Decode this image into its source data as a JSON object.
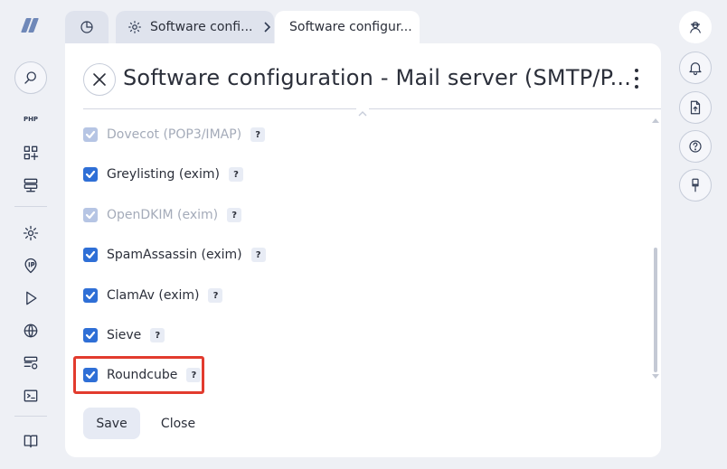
{
  "tabs": [
    {
      "label": "Software confi...",
      "icon": "gear-icon"
    },
    {
      "label": "Software configur..."
    }
  ],
  "panel": {
    "title": "Software configuration - Mail server (SMTP/P...",
    "options": [
      {
        "label": "Dovecot (POP3/IMAP)",
        "checked": true,
        "disabled": true
      },
      {
        "label": "Greylisting (exim)",
        "checked": true,
        "disabled": false
      },
      {
        "label": "OpenDKIM (exim)",
        "checked": true,
        "disabled": true
      },
      {
        "label": "SpamAssassin (exim)",
        "checked": true,
        "disabled": false
      },
      {
        "label": "ClamAv (exim)",
        "checked": true,
        "disabled": false
      },
      {
        "label": "Sieve",
        "checked": true,
        "disabled": false
      },
      {
        "label": "Roundcube",
        "checked": true,
        "disabled": false,
        "highlighted": true
      }
    ],
    "help_label": "?",
    "save_label": "Save",
    "close_label": "Close"
  },
  "left_rail": {
    "php_label": "PHP",
    "icons": [
      "search-icon",
      "php-icon",
      "apps-add-icon",
      "server-icon",
      "gear-icon",
      "ip-icon",
      "play-icon",
      "globe-icon",
      "server-settings-icon",
      "terminal-icon",
      "book-icon"
    ]
  },
  "right_rail": {
    "icons": [
      "avatar-icon",
      "bell-icon",
      "upload-file-icon",
      "help-circle-icon",
      "brush-icon"
    ]
  },
  "colors": {
    "accent": "#2f6fd6",
    "highlight": "#e23b2e",
    "background": "#eef0f5"
  }
}
